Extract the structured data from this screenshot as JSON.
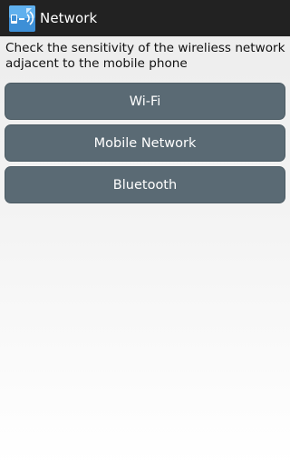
{
  "action_bar": {
    "title": "Network",
    "icon": "network-app-icon"
  },
  "instruction": "Check the sensitivity of the wireliess network adjacent to the mobile phone",
  "buttons": {
    "wifi": "Wi-Fi",
    "mobile": "Mobile Network",
    "bluetooth": "Bluetooth"
  },
  "colors": {
    "action_bar": "#222222",
    "button": "#5a6a74"
  }
}
